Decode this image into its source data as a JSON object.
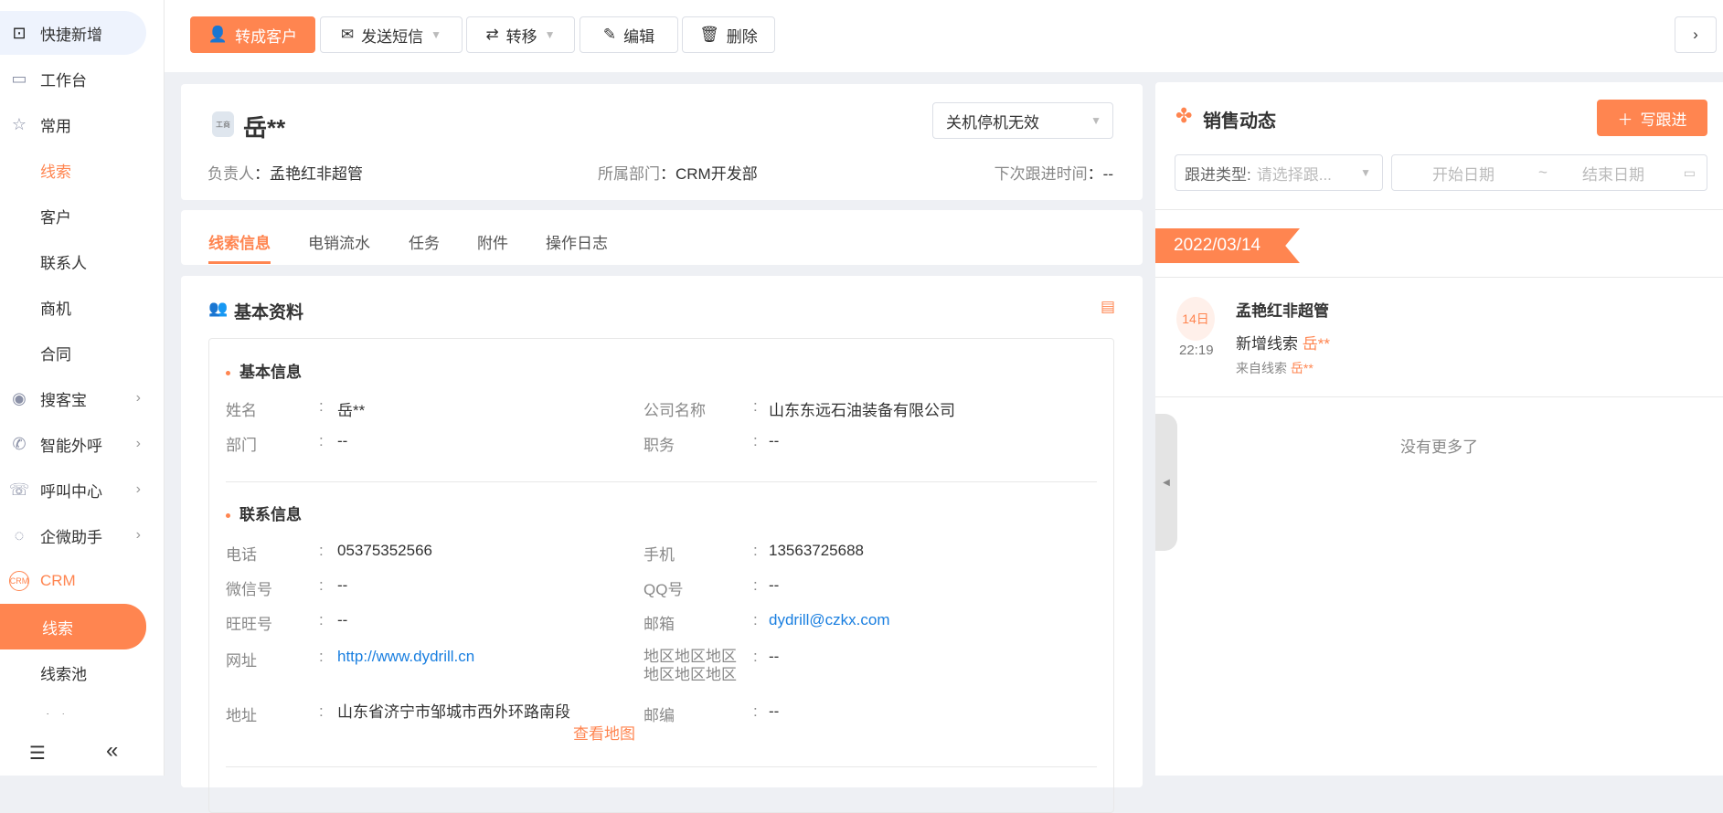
{
  "sidebar": {
    "quick_add": "快捷新增",
    "items": [
      {
        "label": "工作台"
      },
      {
        "label": "常用"
      },
      {
        "label": "线索"
      },
      {
        "label": "客户"
      },
      {
        "label": "联系人"
      },
      {
        "label": "商机"
      },
      {
        "label": "合同"
      },
      {
        "label": "搜客宝"
      },
      {
        "label": "智能外呼"
      },
      {
        "label": "呼叫中心"
      },
      {
        "label": "企微助手"
      },
      {
        "label": "CRM"
      },
      {
        "label": "线索"
      },
      {
        "label": "线索池"
      },
      {
        "label": "客户"
      }
    ]
  },
  "toolbar": {
    "convert": "转成客户",
    "sms": "发送短信",
    "transfer": "转移",
    "edit": "编辑",
    "delete": "删除"
  },
  "header": {
    "badge": "工商",
    "name": "岳**",
    "status": "关机停机无效",
    "owner_label": "负责人",
    "owner": "孟艳红非超管",
    "dept_label": "所属部门",
    "dept": "CRM开发部",
    "next_label": "下次跟进时间",
    "next": "--"
  },
  "tabs": [
    "线索信息",
    "电销流水",
    "任务",
    "附件",
    "操作日志"
  ],
  "basic": {
    "title": "基本资料",
    "section1": "基本信息",
    "section2": "联系信息",
    "fields1": [
      [
        "姓名",
        "岳**"
      ],
      [
        "公司名称",
        "山东东远石油装备有限公司"
      ],
      [
        "部门",
        "--"
      ],
      [
        "职务",
        "--"
      ]
    ],
    "fields2": [
      [
        "电话",
        "05375352566"
      ],
      [
        "手机",
        "13563725688"
      ],
      [
        "微信号",
        "--"
      ],
      [
        "QQ号",
        "--"
      ],
      [
        "旺旺号",
        "--"
      ],
      [
        "邮箱",
        "dydrill@czkx.com"
      ],
      [
        "网址",
        "http://www.dydrill.cn"
      ],
      [
        "地区地区地区地区地区地区",
        "--"
      ],
      [
        "地址",
        "山东省济宁市邹城市西外环路南段"
      ],
      [
        "邮编",
        "--"
      ]
    ],
    "map_link": "查看地图"
  },
  "sales": {
    "title": "销售动态",
    "write": "写跟进",
    "type_label": "跟进类型:",
    "type_placeholder": "请选择跟...",
    "start": "开始日期",
    "sep": "~",
    "end": "结束日期",
    "date": "2022/03/14",
    "entry": {
      "day": "14日",
      "time": "22:19",
      "user": "孟艳红非超管",
      "action": "新增线索",
      "target": "岳**",
      "from": "来自线索",
      "from_target": "岳**"
    },
    "no_more": "没有更多了"
  },
  "colors": {
    "accent": "#ff8550",
    "link": "#1a7fe0"
  }
}
